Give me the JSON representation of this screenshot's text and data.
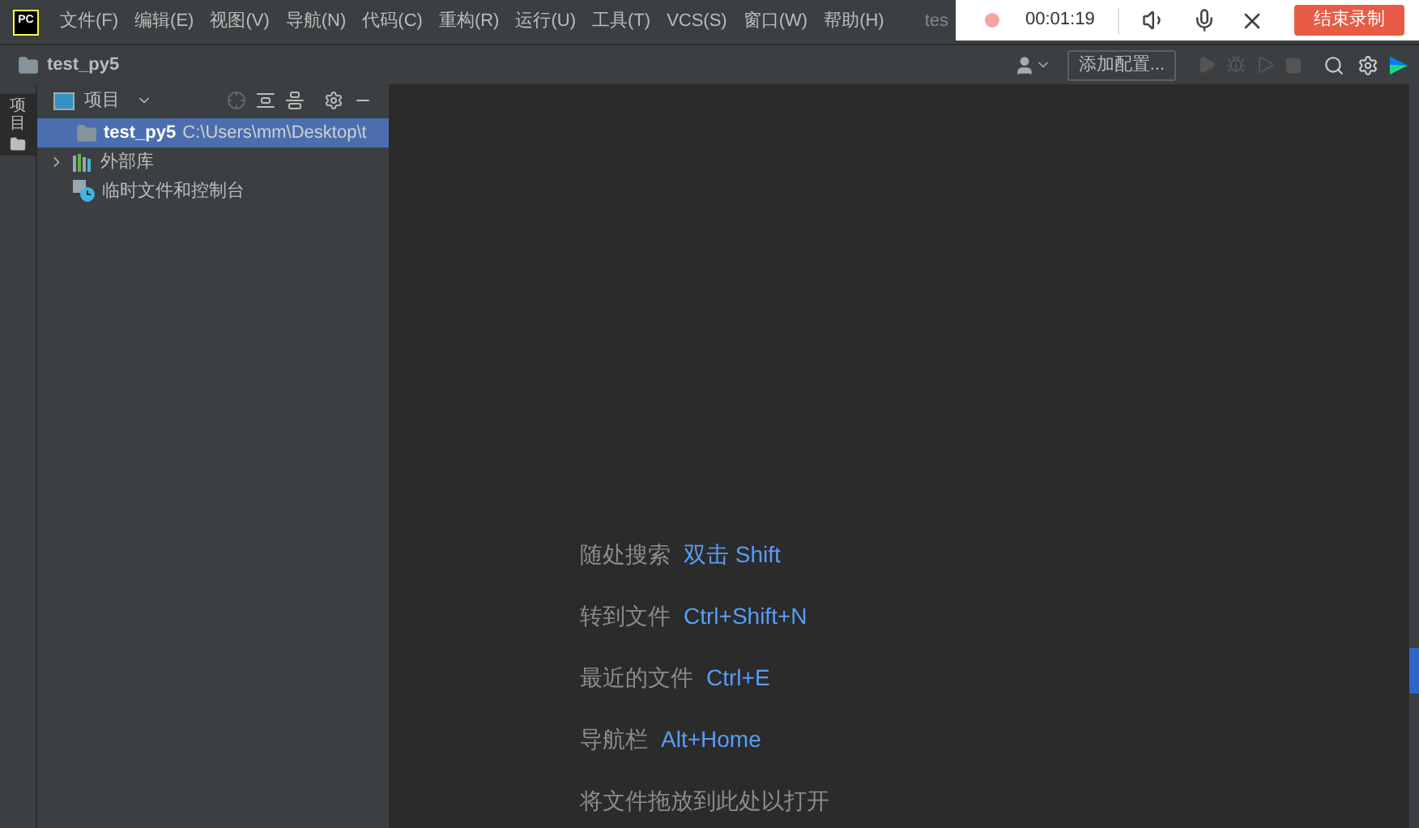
{
  "menu_bar": {
    "logo": "PC",
    "items": [
      "文件(F)",
      "编辑(E)",
      "视图(V)",
      "导航(N)",
      "代码(C)",
      "重构(R)",
      "运行(U)",
      "工具(T)",
      "VCS(S)",
      "窗口(W)",
      "帮助(H)"
    ],
    "title_fragment": "tes"
  },
  "recording": {
    "time": "00:01:19",
    "stop_button": "结束录制"
  },
  "nav_bar": {
    "project": "test_py5",
    "run_config": "添加配置..."
  },
  "side_tab": {
    "label": "项目",
    "selected": true
  },
  "project_panel": {
    "title": "项目",
    "tree": [
      {
        "kind": "folder",
        "name": "test_py5",
        "path": "C:\\Users\\mm\\Desktop\\t",
        "selected": true
      },
      {
        "kind": "library",
        "name": "外部库",
        "selected": false,
        "expanded": false
      },
      {
        "kind": "scratch",
        "name": "临时文件和控制台",
        "selected": false
      }
    ]
  },
  "editor_hints": [
    {
      "label": "随处搜索",
      "shortcut": "双击 Shift"
    },
    {
      "label": "转到文件",
      "shortcut": "Ctrl+Shift+N"
    },
    {
      "label": "最近的文件",
      "shortcut": "Ctrl+E"
    },
    {
      "label": "导航栏",
      "shortcut": "Alt+Home"
    },
    {
      "label": "将文件拖放到此处以打开"
    }
  ]
}
